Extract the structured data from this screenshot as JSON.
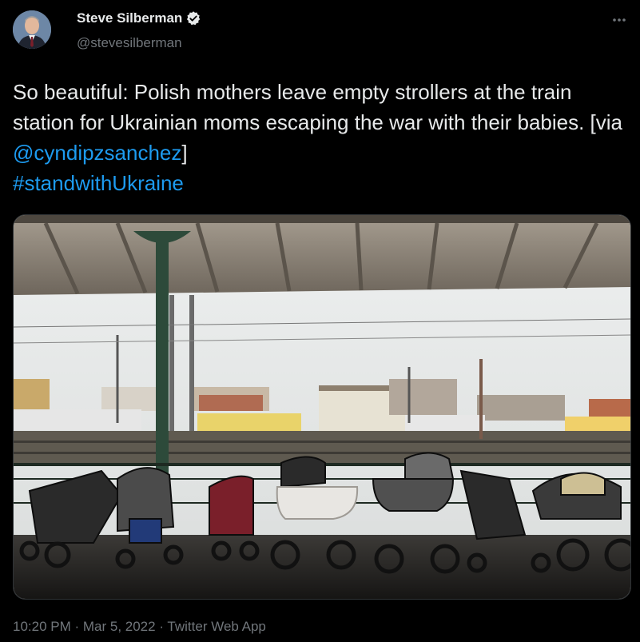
{
  "author": {
    "name": "Steve Silberman",
    "handle": "@stevesilberman",
    "verified": true,
    "avatar_icon": "profile-photo"
  },
  "tweet": {
    "text_prefix": "So beautiful: Polish mothers leave empty strollers at the train station for Ukrainian moms escaping the war with their babies. [via ",
    "mention": "@cyndipzsanchez",
    "text_suffix": "]",
    "hashtag": "#standwithUkraine"
  },
  "media": {
    "type": "photo",
    "icon": "photo-strollers-train-station"
  },
  "meta": {
    "time": "10:20 PM",
    "sep1": " · ",
    "date": "Mar 5, 2022",
    "sep2": " · ",
    "source": "Twitter Web App"
  },
  "colors": {
    "background": "#000000",
    "text": "#e7e9ea",
    "secondary": "#71767b",
    "link": "#1d9bf0"
  }
}
